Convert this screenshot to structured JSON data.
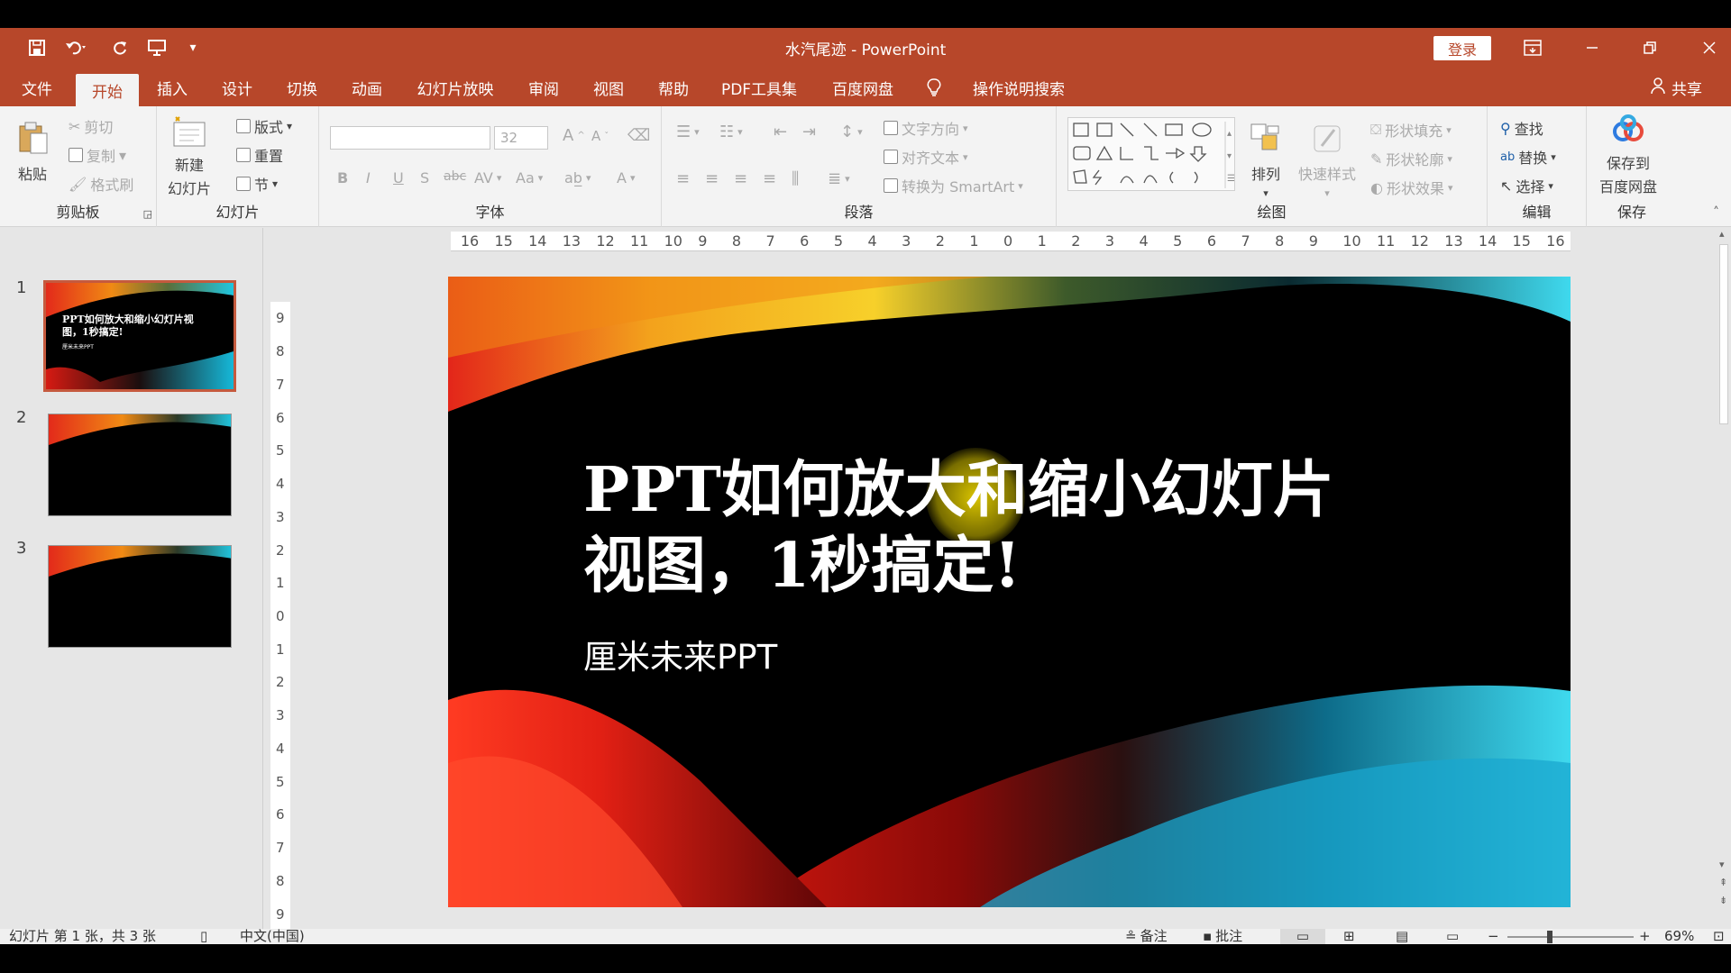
{
  "window": {
    "title": "水汽尾迹  -  PowerPoint",
    "login": "登录",
    "share": "共享",
    "accent_color": "#b7472a"
  },
  "quick_access": {
    "icons": [
      "save-icon",
      "undo-icon",
      "redo-icon",
      "start-presentation-icon",
      "customize-icon"
    ]
  },
  "tabs": [
    "文件",
    "开始",
    "插入",
    "设计",
    "切换",
    "动画",
    "幻灯片放映",
    "审阅",
    "视图",
    "帮助",
    "PDF工具集",
    "百度网盘",
    "操作说明搜索"
  ],
  "active_tab": "开始",
  "ribbon": {
    "clipboard": {
      "label": "剪贴板",
      "paste": "粘贴",
      "cut": "剪切",
      "copy": "复制",
      "format_painter": "格式刷"
    },
    "slides": {
      "label": "幻灯片",
      "new_slide_line1": "新建",
      "new_slide_line2": "幻灯片",
      "layout": "版式",
      "reset": "重置",
      "section": "节"
    },
    "font": {
      "label": "字体",
      "font_name": "",
      "font_size": "32",
      "bold": "B",
      "italic": "I",
      "underline": "U",
      "shadow": "S",
      "strike": "abc",
      "spacing": "AV",
      "case": "Aa",
      "color": "A",
      "grow": "A",
      "shrink": "A"
    },
    "paragraph": {
      "label": "段落",
      "text_direction": "文字方向",
      "align_text": "对齐文本",
      "smartart": "转换为 SmartArt"
    },
    "drawing": {
      "label": "绘图",
      "arrange": "排列",
      "quick_styles": "快速样式",
      "shape_fill": "形状填充",
      "shape_outline": "形状轮廓",
      "shape_effects": "形状效果"
    },
    "editing": {
      "label": "编辑",
      "find": "查找",
      "replace": "替换",
      "select": "选择"
    },
    "save": {
      "label": "保存",
      "save_to_line1": "保存到",
      "save_to_line2": "百度网盘"
    }
  },
  "slides_pane": [
    {
      "number": "1",
      "title": "PPT如何放大和缩小幻灯片视图，1秒搞定!",
      "subtitle": "厘米未来PPT",
      "selected": true
    },
    {
      "number": "2",
      "title": "",
      "subtitle": "",
      "selected": false
    },
    {
      "number": "3",
      "title": "",
      "subtitle": "",
      "selected": false
    }
  ],
  "ruler": {
    "horizontal": [
      "16",
      "15",
      "14",
      "13",
      "12",
      "11",
      "10",
      "9",
      "8",
      "7",
      "6",
      "5",
      "4",
      "3",
      "2",
      "1",
      "0",
      "1",
      "2",
      "3",
      "4",
      "5",
      "6",
      "7",
      "8",
      "9",
      "10",
      "11",
      "12",
      "13",
      "14",
      "15",
      "16"
    ],
    "vertical": [
      "9",
      "8",
      "7",
      "6",
      "5",
      "4",
      "3",
      "2",
      "1",
      "0",
      "1",
      "2",
      "3",
      "4",
      "5",
      "6",
      "7",
      "8",
      "9"
    ]
  },
  "slide": {
    "title_line1": "PPT如何放大和缩小幻灯片",
    "title_line2": "视图，1秒搞定!",
    "subtitle": "厘米未来PPT"
  },
  "status": {
    "slide_info": "幻灯片 第 1 张，共 3 张",
    "language": "中文(中国)",
    "notes": "备注",
    "comments": "批注",
    "zoom": "69%"
  }
}
